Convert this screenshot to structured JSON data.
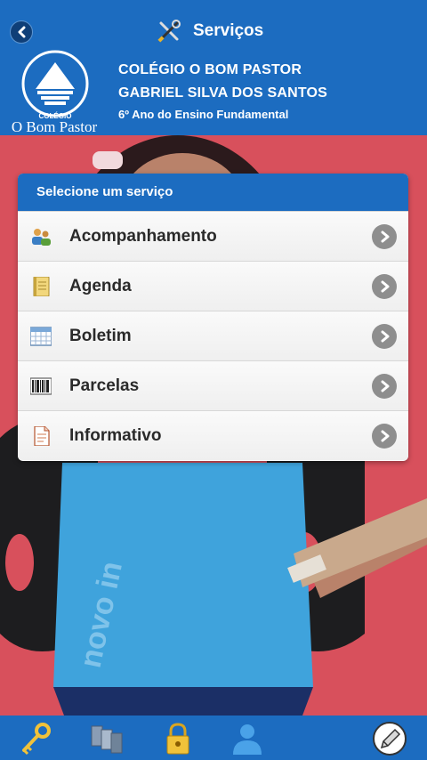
{
  "header": {
    "title": "Serviços",
    "back_icon": "chevron-left-icon",
    "title_icon": "tools-icon",
    "logo_text": "O Bom Pastor",
    "logo_subtext": "COLÉGIO"
  },
  "school": {
    "name": "COLÉGIO O BOM PASTOR",
    "student": "GABRIEL SILVA DOS SANTOS",
    "grade": "6º Ano do Ensino Fundamental"
  },
  "services": {
    "title": "Selecione um serviço",
    "items": [
      {
        "label": "Acompanhamento",
        "icon": "people-icon"
      },
      {
        "label": "Agenda",
        "icon": "notebook-icon"
      },
      {
        "label": "Boletim",
        "icon": "calendar-grid-icon"
      },
      {
        "label": "Parcelas",
        "icon": "barcode-icon"
      },
      {
        "label": "Informativo",
        "icon": "document-icon"
      }
    ]
  },
  "photo_text": "novo in",
  "footer": {
    "items": [
      {
        "icon": "key-icon"
      },
      {
        "icon": "database-icon"
      },
      {
        "icon": "lock-icon"
      },
      {
        "icon": "user-icon"
      },
      {
        "icon": "pencil-icon"
      }
    ]
  },
  "colors": {
    "primary": "#1c6cc0",
    "background": "#d8505c",
    "shirt": "#3fa3dc"
  }
}
